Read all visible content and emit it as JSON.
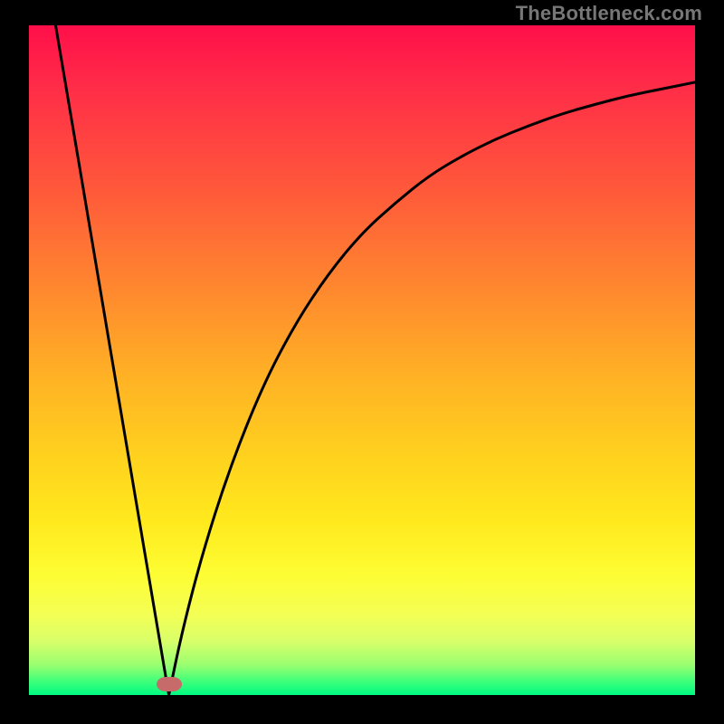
{
  "attribution": "TheBottleneck.com",
  "chart_data": {
    "type": "line",
    "title": "",
    "xlabel": "",
    "ylabel": "",
    "x_range": [
      0,
      1
    ],
    "y_range": [
      0,
      1
    ],
    "gradient_colors": {
      "top": "#ff0f4a",
      "mid_orange": "#ff8a2e",
      "mid_yellow": "#ffe91d",
      "bottom": "#00fa83"
    },
    "curve": {
      "description": "V-shaped curve touching zero at x≈0.21; left branch linear from (0.04,1.0) down to vertex; right branch rises asymptotically toward y≈0.92 as x→1",
      "vertex_x": 0.21,
      "left_start": {
        "x": 0.04,
        "y": 1.0
      },
      "right_end": {
        "x": 1.0,
        "y": 0.915
      },
      "samples_x": [
        0.04,
        0.08,
        0.12,
        0.16,
        0.2,
        0.21,
        0.23,
        0.26,
        0.3,
        0.35,
        0.4,
        0.45,
        0.5,
        0.55,
        0.6,
        0.65,
        0.7,
        0.75,
        0.8,
        0.85,
        0.9,
        0.95,
        1.0
      ],
      "samples_y": [
        1.0,
        0.765,
        0.529,
        0.294,
        0.059,
        0.0,
        0.095,
        0.21,
        0.335,
        0.46,
        0.555,
        0.63,
        0.69,
        0.735,
        0.775,
        0.805,
        0.83,
        0.85,
        0.868,
        0.882,
        0.895,
        0.905,
        0.915
      ]
    },
    "marker": {
      "shape": "pill",
      "color": "#c66a6a",
      "x": 0.21,
      "y": 0.0
    }
  }
}
